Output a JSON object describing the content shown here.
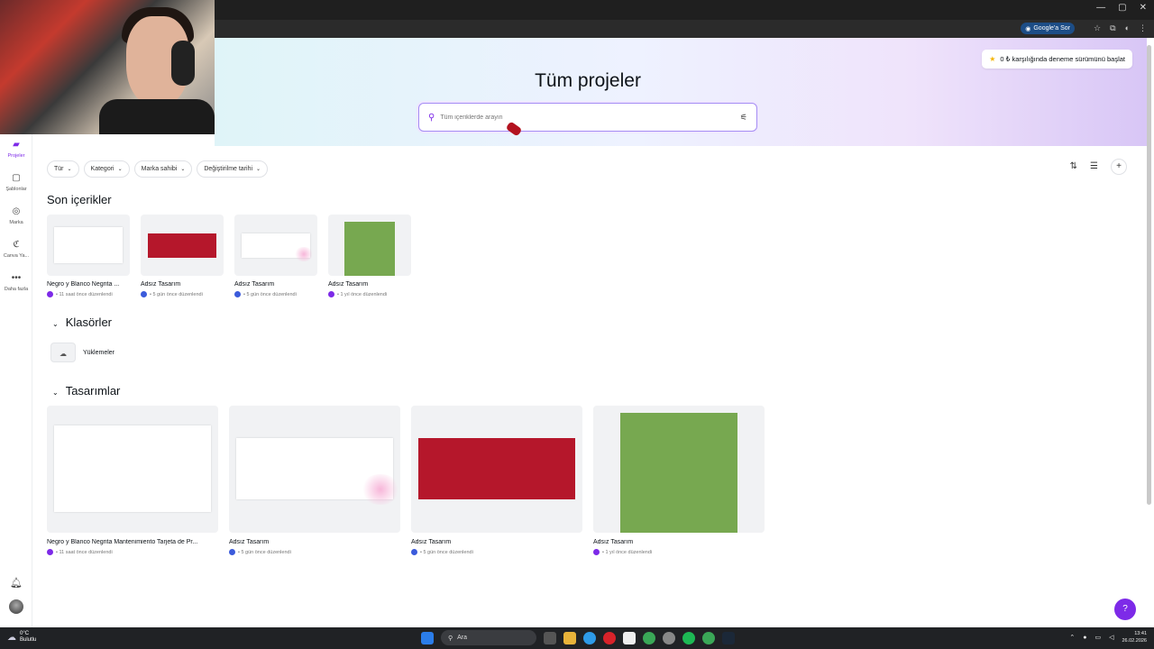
{
  "browser": {
    "google_sor_label": "Google'a Sor",
    "window_controls": [
      "—",
      "▢",
      "✕"
    ]
  },
  "header": {
    "page_title": "Tüm projeler",
    "search_placeholder": "Tüm içeriklerde arayın",
    "trial_label": "0 ₺ karşılığında deneme sürümünü başlat"
  },
  "sidebar": {
    "items": [
      {
        "label": "Projeler",
        "icon": "folder-icon"
      },
      {
        "label": "Şablonlar",
        "icon": "templates-icon"
      },
      {
        "label": "Marka",
        "icon": "brand-icon"
      },
      {
        "label": "Canva Ya...",
        "icon": "canva-ai-icon"
      },
      {
        "label": "Daha fazla",
        "icon": "more-icon"
      }
    ]
  },
  "filters": [
    "Tür",
    "Kategori",
    "Marka sahibi",
    "Değiştirilme tarihi"
  ],
  "sections": {
    "recent": "Son içerikler",
    "folders": "Klasörler",
    "designs": "Tasarımlar"
  },
  "recent_items": [
    {
      "title": "Negro y Blanco Negrita ...",
      "meta": "• 11 saat önce düzenlendi"
    },
    {
      "title": "Adsız Tasarım",
      "meta": "• 5 gün önce düzenlendi"
    },
    {
      "title": "Adsız Tasarım",
      "meta": "• 5 gün önce düzenlendi"
    },
    {
      "title": "Adsız Tasarım",
      "meta": "• 1 yıl önce düzenlendi"
    }
  ],
  "folders": [
    {
      "title": "Yüklemeler"
    }
  ],
  "designs": [
    {
      "title": "Negro y Blanco Negrita Mantenimiento Tarjeta de Pr...",
      "meta": "• 11 saat önce düzenlendi"
    },
    {
      "title": "Adsız Tasarım",
      "meta": "• 5 gün önce düzenlendi"
    },
    {
      "title": "Adsız Tasarım",
      "meta": "• 5 gün önce düzenlendi"
    },
    {
      "title": "Adsız Tasarım",
      "meta": "• 1 yıl önce düzenlendi"
    }
  ],
  "help_label": "?",
  "taskbar": {
    "weather_temp": "0°C",
    "weather_desc": "Bulutlu",
    "search_label": "Ara",
    "time": "13:41",
    "date": "26.02.2026"
  }
}
